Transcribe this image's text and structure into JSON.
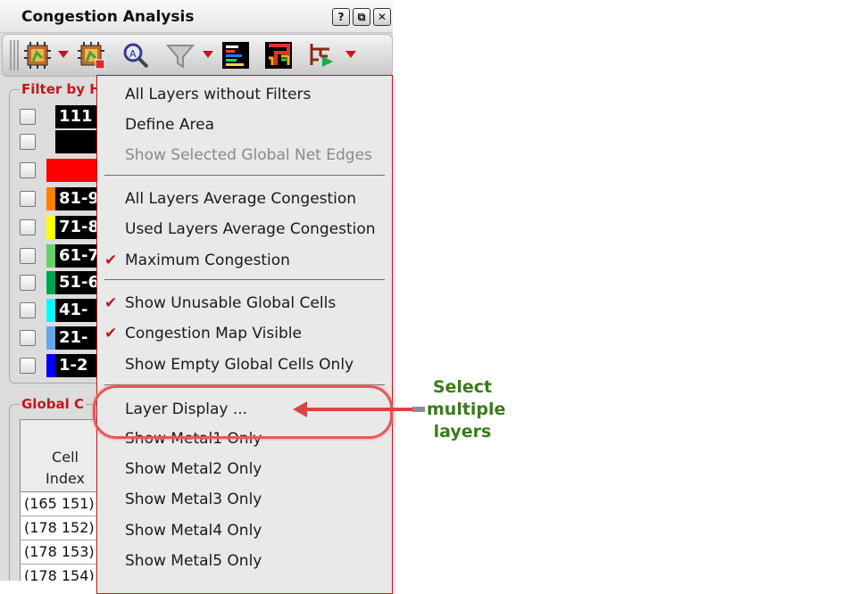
{
  "panel": {
    "title": "Congestion Analysis",
    "help_label": "?",
    "float_label": "⧉",
    "close_label": "✕"
  },
  "toolbar": {
    "icons": [
      "congestion-map-icon",
      "congestion-map-clear-icon",
      "zoom-search-icon",
      "filter-funnel-icon",
      "layer-bars-icon",
      "routing-layout-icon",
      "net-tree-icon"
    ]
  },
  "filter": {
    "legend": "Filter by H",
    "rows": [
      {
        "label": "111",
        "color": "#000000"
      },
      {
        "label": "",
        "color": "#000000"
      },
      {
        "label": "",
        "color": "#ff0000"
      },
      {
        "label": "81-9",
        "color": "#ff7f00"
      },
      {
        "label": "71-8",
        "color": "#ffff00"
      },
      {
        "label": "61-7",
        "color": "#66d06b"
      },
      {
        "label": "51-6",
        "color": "#00a64f"
      },
      {
        "label": "41-",
        "color": "#00ffff"
      },
      {
        "label": "21-",
        "color": "#6aa4ea"
      },
      {
        "label": "1-2",
        "color": "#0000ff"
      }
    ]
  },
  "global": {
    "legend": "Global C",
    "header_line1": "Cell",
    "header_line2": "Index",
    "cells": [
      "(165 151)",
      "(178 152)",
      "(178 153)",
      "(178 154)"
    ]
  },
  "menu": {
    "items": [
      {
        "label": "All Layers without Filters",
        "checked": false,
        "disabled": false
      },
      {
        "label": "Define Area",
        "checked": false,
        "disabled": false
      },
      {
        "label": "Show Selected Global Net Edges",
        "checked": false,
        "disabled": true
      },
      {
        "label": "All Layers Average Congestion",
        "checked": false,
        "disabled": false
      },
      {
        "label": "Used Layers Average Congestion",
        "checked": false,
        "disabled": false
      },
      {
        "label": "Maximum Congestion",
        "checked": true,
        "disabled": false
      },
      {
        "label": "Show Unusable Global Cells",
        "checked": true,
        "disabled": false
      },
      {
        "label": "Congestion Map Visible",
        "checked": true,
        "disabled": false
      },
      {
        "label": "Show Empty Global Cells Only",
        "checked": false,
        "disabled": false
      },
      {
        "label": "Layer Display ...",
        "checked": false,
        "disabled": false
      },
      {
        "label": "Show Metal1 Only",
        "checked": false,
        "disabled": false
      },
      {
        "label": "Show Metal2 Only",
        "checked": false,
        "disabled": false
      },
      {
        "label": "Show Metal3 Only",
        "checked": false,
        "disabled": false
      },
      {
        "label": "Show Metal4 Only",
        "checked": false,
        "disabled": false
      },
      {
        "label": "Show Metal5 Only",
        "checked": false,
        "disabled": false
      }
    ],
    "check_mark": "✔"
  },
  "annotation": {
    "line1": "Select",
    "line2": "multiple",
    "line3": "layers"
  }
}
